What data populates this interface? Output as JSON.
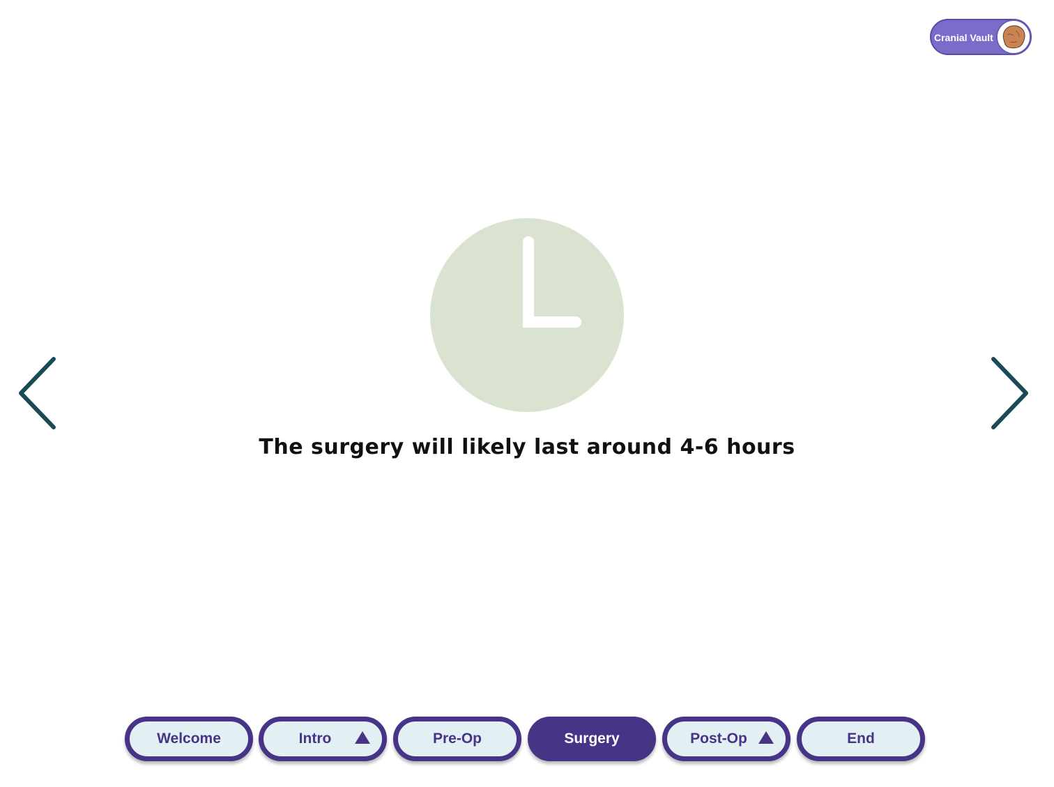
{
  "badge": {
    "label": "Cranial Vault",
    "avatar_icon": "skull-avatar-icon",
    "colors": {
      "background": "#7b6cc9",
      "avatar_fill": "#c98355"
    }
  },
  "main": {
    "illustration_icon": "clock-icon",
    "caption": "The surgery will likely last around 4-6 hours"
  },
  "navigation": {
    "prev_icon": "chevron-left-icon",
    "next_icon": "chevron-right-icon",
    "color": "#1b4a57"
  },
  "tabs": [
    {
      "label": "Welcome",
      "active": false,
      "has_expander": false
    },
    {
      "label": "Intro",
      "active": false,
      "has_expander": true,
      "expander_icon": "triangle-up-icon"
    },
    {
      "label": "Pre-Op",
      "active": false,
      "has_expander": false
    },
    {
      "label": "Surgery",
      "active": true,
      "has_expander": false
    },
    {
      "label": "Post-Op",
      "active": false,
      "has_expander": true,
      "expander_icon": "triangle-up-icon"
    },
    {
      "label": "End",
      "active": false,
      "has_expander": false
    }
  ],
  "colors": {
    "accent": "#473487",
    "tab_fill": "#e2f0f3",
    "clock_face": "#dae3cf"
  }
}
